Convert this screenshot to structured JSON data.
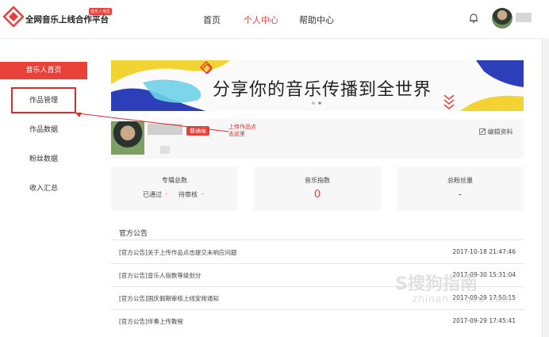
{
  "header": {
    "logo_text": "全网音乐上线合作平台",
    "logo_badge": "音乐人专区",
    "nav": [
      "首页",
      "个人中心",
      "帮助中心"
    ],
    "active_nav": "个人中心"
  },
  "sidebar": {
    "items": [
      "音乐人首页",
      "作品管理",
      "作品数据",
      "粉丝数据",
      "收入汇总"
    ],
    "active": "音乐人首页"
  },
  "banner": {
    "title": "分享你的音乐传播到全世界"
  },
  "profile": {
    "badge": "普通版",
    "annotation": [
      "上传作品点",
      "击这里"
    ],
    "edit_label": "编辑资料"
  },
  "stats": {
    "works": {
      "title": "专辑总数",
      "passed_label": "已通过",
      "passed_value": "-",
      "pending_label": "待审核",
      "pending_value": "-"
    },
    "music_index": {
      "title": "音乐指数",
      "value": "0"
    },
    "fans": {
      "title": "总粉丝量",
      "value": "-"
    }
  },
  "notices": {
    "title": "官方公告",
    "rows": [
      {
        "text": "[官方公告]关于上传作品点击提交未响应问题",
        "time": "2017-10-18 21:47:46"
      },
      {
        "text": "[官方公告]音乐人指数等级划分",
        "time": "2017-09-30 15:31:04"
      },
      {
        "text": "[官方公告]国庆假期审核上线安排通知",
        "time": "2017-09-29 17:50:15"
      },
      {
        "text": "[官方公告]伴奏上传教程",
        "time": "2017-09-29 17:45:41"
      }
    ]
  },
  "watermark": {
    "main": "S搜狗指南",
    "sub": "zhinan.sogou.com"
  },
  "colors": {
    "accent": "#e8413a",
    "highlight_box": "#e02a2a"
  }
}
